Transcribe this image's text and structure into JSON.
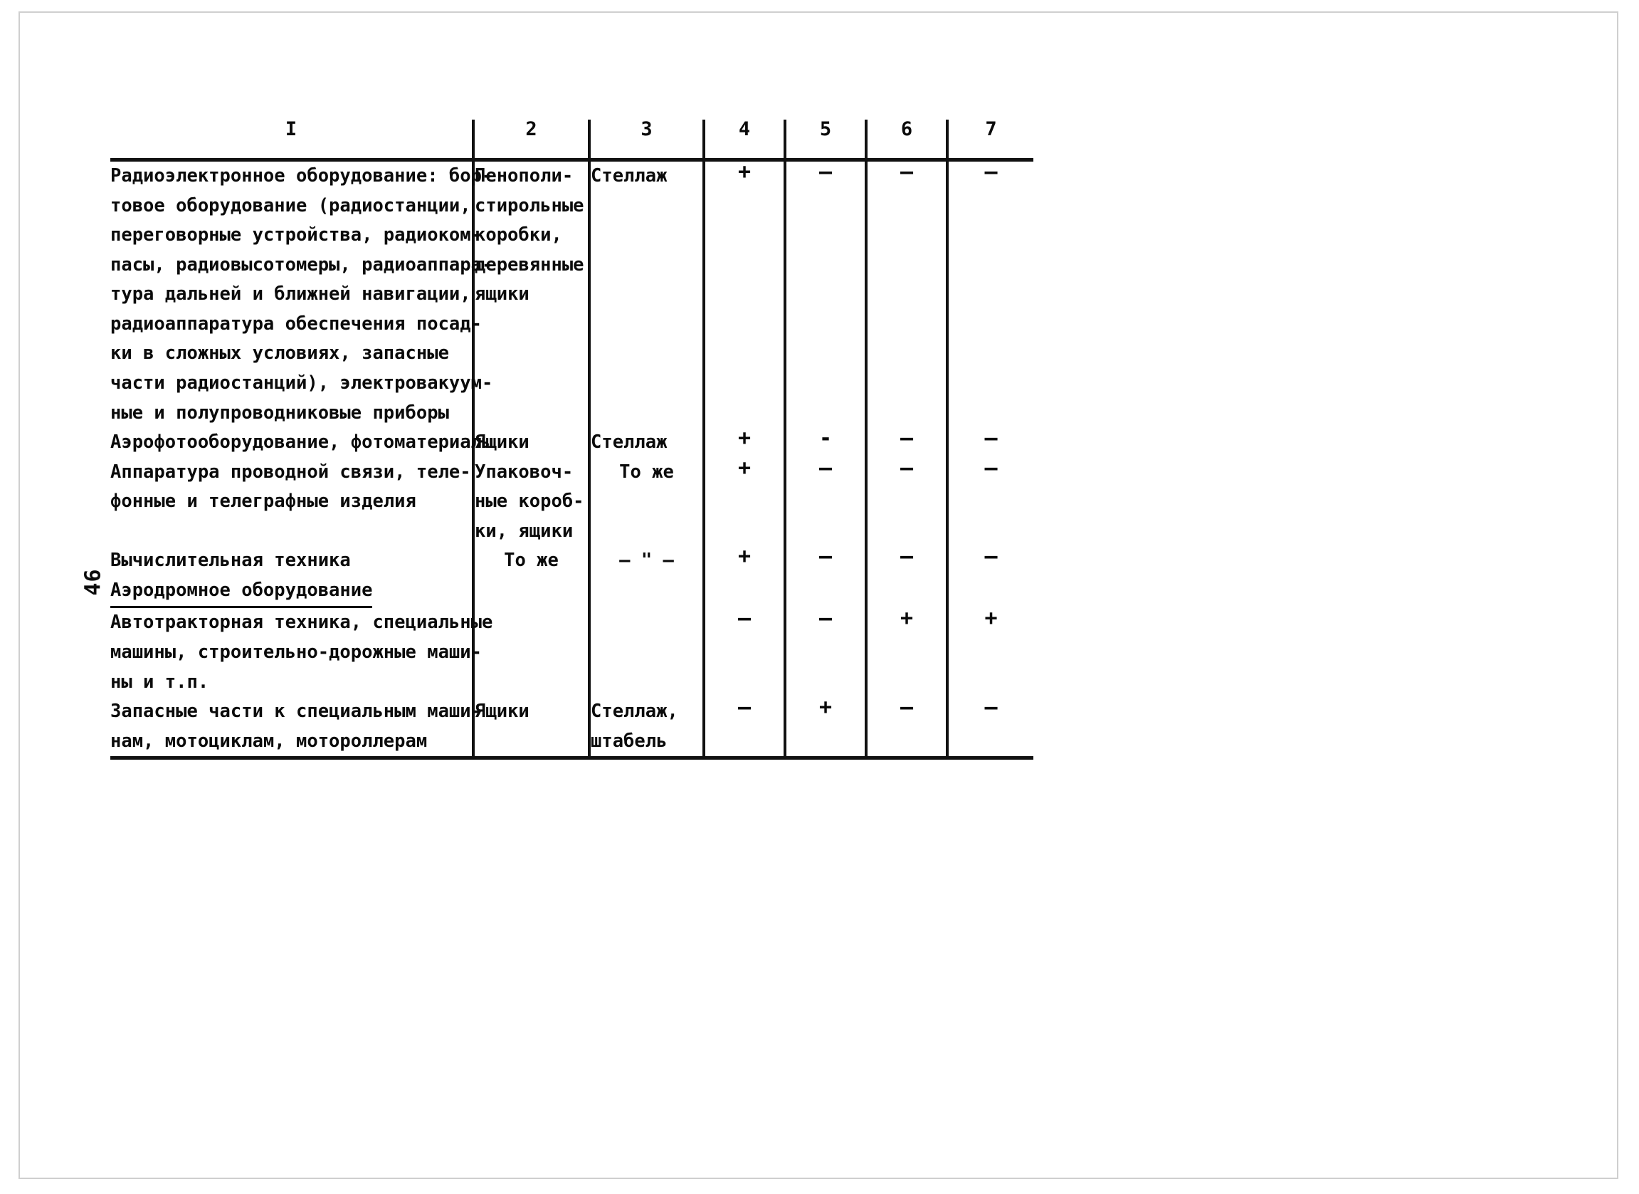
{
  "page": {
    "folio": "46"
  },
  "table": {
    "headers": [
      "I",
      "2",
      "3",
      "4",
      "5",
      "6",
      "7"
    ],
    "rows": [
      {
        "c1": [
          "Радиоэлектронное оборудование: бор-",
          "товое оборудование (радиостанции,",
          "переговорные устройства, радиоком-",
          "пасы, радиовысотомеры, радиоаппара-",
          "тура дальней и ближней навигации,",
          "радиоаппаратура обеспечения посад-",
          "ки в сложных условиях, запасные",
          "части радиостанций), электровакуум-",
          "ные и полупроводниковые приборы"
        ],
        "c2": [
          "Пенополи-",
          "стирольные",
          "коробки,",
          "деревянные",
          "ящики"
        ],
        "c3": [
          "Стеллаж"
        ],
        "c2_align": "left",
        "c3_align": "left",
        "c4": "+",
        "c5": "–",
        "c6": "–",
        "c7": "–"
      },
      {
        "c1": [
          "Аэрофотооборудование, фотоматериалы"
        ],
        "c2": [
          "Ящики"
        ],
        "c3": [
          "Стеллаж"
        ],
        "c2_align": "left",
        "c3_align": "left",
        "c4": "+",
        "c5": "-",
        "c6": "–",
        "c7": "–"
      },
      {
        "c1": [
          "Аппаратура проводной связи, теле-",
          "фонные и телеграфные изделия"
        ],
        "c2": [
          "Упаковоч-",
          "ные короб-",
          "ки, ящики"
        ],
        "c3": [
          "То же"
        ],
        "c2_align": "left",
        "c3_align": "center",
        "c4": "+",
        "c5": "–",
        "c6": "–",
        "c7": "–"
      },
      {
        "c1": [
          "Вычислительная техника"
        ],
        "c2": [
          "То же"
        ],
        "c3": [
          "– \" –"
        ],
        "c2_align": "center",
        "c3_align": "center",
        "c4": "+",
        "c5": "–",
        "c6": "–",
        "c7": "–"
      },
      {
        "c1": [
          "Аэродромное оборудование"
        ],
        "c1_underline": true,
        "c2": [],
        "c3": [],
        "c2_align": "left",
        "c3_align": "left",
        "c4": "",
        "c5": "",
        "c6": "",
        "c7": ""
      },
      {
        "c1": [
          "Автотракторная техника, специальные",
          "машины, строительно-дорожные маши-",
          "ны и т.п."
        ],
        "c2": [],
        "c3": [],
        "c2_align": "left",
        "c3_align": "left",
        "c4": "–",
        "c5": "–",
        "c6": "+",
        "c7": "+"
      },
      {
        "c1": [
          "Запасные части к специальным маши-",
          "нам, мотоциклам, мотороллерам"
        ],
        "c2": [
          "Ящики"
        ],
        "c3": [
          "Стеллаж,",
          "штабель"
        ],
        "c2_align": "left",
        "c3_align": "left",
        "c4": "–",
        "c5": "+",
        "c6": "–",
        "c7": "–"
      }
    ]
  }
}
